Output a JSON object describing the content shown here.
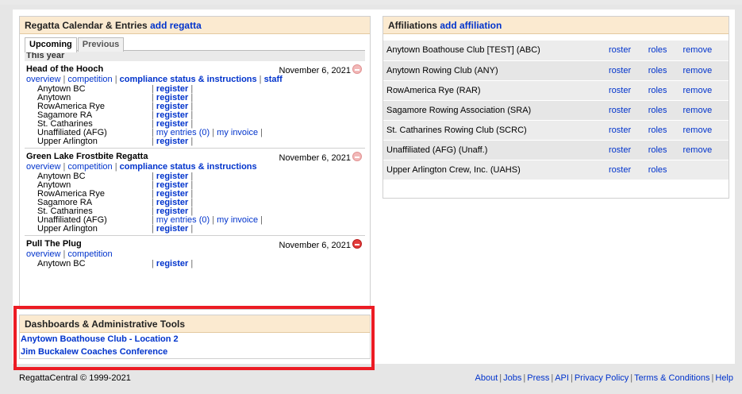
{
  "regatta_panel": {
    "title": "Regatta Calendar & Entries",
    "add_link": "add regatta",
    "tabs": [
      "Upcoming",
      "Previous"
    ],
    "section_label": "This year",
    "regattas": [
      {
        "name": "Head of the Hooch",
        "date": "November 6, 2021",
        "links": [
          "overview",
          "competition",
          "compliance status & instructions",
          "staff"
        ],
        "clubs": [
          {
            "name": "Anytown BC",
            "actions": [
              "register"
            ]
          },
          {
            "name": "Anytown",
            "actions": [
              "register"
            ]
          },
          {
            "name": "RowAmerica Rye",
            "actions": [
              "register"
            ]
          },
          {
            "name": "Sagamore RA",
            "actions": [
              "register"
            ]
          },
          {
            "name": "St. Catharines",
            "actions": [
              "register"
            ]
          },
          {
            "name": "Unaffiliated (AFG)",
            "actions": [
              "my entries (0)",
              "my invoice"
            ]
          },
          {
            "name": "Upper Arlington",
            "actions": [
              "register"
            ]
          }
        ]
      },
      {
        "name": "Green Lake Frostbite Regatta",
        "date": "November 6, 2021",
        "links": [
          "overview",
          "competition",
          "compliance status & instructions"
        ],
        "clubs": [
          {
            "name": "Anytown BC",
            "actions": [
              "register"
            ]
          },
          {
            "name": "Anytown",
            "actions": [
              "register"
            ]
          },
          {
            "name": "RowAmerica Rye",
            "actions": [
              "register"
            ]
          },
          {
            "name": "Sagamore RA",
            "actions": [
              "register"
            ]
          },
          {
            "name": "St. Catharines",
            "actions": [
              "register"
            ]
          },
          {
            "name": "Unaffiliated (AFG)",
            "actions": [
              "my entries (0)",
              "my invoice"
            ]
          },
          {
            "name": "Upper Arlington",
            "actions": [
              "register"
            ]
          }
        ]
      },
      {
        "name": "Pull The Plug",
        "date": "November 6, 2021",
        "links": [
          "overview",
          "competition"
        ],
        "clubs": [
          {
            "name": "Anytown BC",
            "actions": [
              "register"
            ]
          }
        ]
      }
    ]
  },
  "dashboards": {
    "title": "Dashboards & Administrative Tools",
    "links": [
      "Anytown Boathouse Club - Location 2",
      "Jim Buckalew Coaches Conference"
    ]
  },
  "affiliations": {
    "title": "Affiliations",
    "add_link": "add affiliation",
    "rows": [
      {
        "name": "Anytown Boathouse Club [TEST] (ABC)",
        "roster": "roster",
        "roles": "roles",
        "remove": "remove"
      },
      {
        "name": "Anytown Rowing Club (ANY)",
        "roster": "roster",
        "roles": "roles",
        "remove": "remove"
      },
      {
        "name": "RowAmerica Rye (RAR)",
        "roster": "roster",
        "roles": "roles",
        "remove": "remove"
      },
      {
        "name": "Sagamore Rowing Association (SRA)",
        "roster": "roster",
        "roles": "roles",
        "remove": "remove"
      },
      {
        "name": "St. Catharines Rowing Club (SCRC)",
        "roster": "roster",
        "roles": "roles",
        "remove": "remove"
      },
      {
        "name": "Unaffiliated (AFG) (Unaff.)",
        "roster": "roster",
        "roles": "roles",
        "remove": "remove"
      },
      {
        "name": "Upper Arlington Crew, Inc. (UAHS)",
        "roster": "roster",
        "roles": "roles",
        "remove": ""
      }
    ]
  },
  "footer": {
    "copyright": "RegattaCentral © 1999-2021",
    "links": [
      "About",
      "Jobs",
      "Press",
      "API",
      "Privacy Policy",
      "Terms & Conditions",
      "Help"
    ]
  },
  "colors": {
    "link": "#0033cc",
    "panel_header": "#fbead0",
    "highlight": "#ec1c24",
    "remove_active": "#e23b3b"
  }
}
